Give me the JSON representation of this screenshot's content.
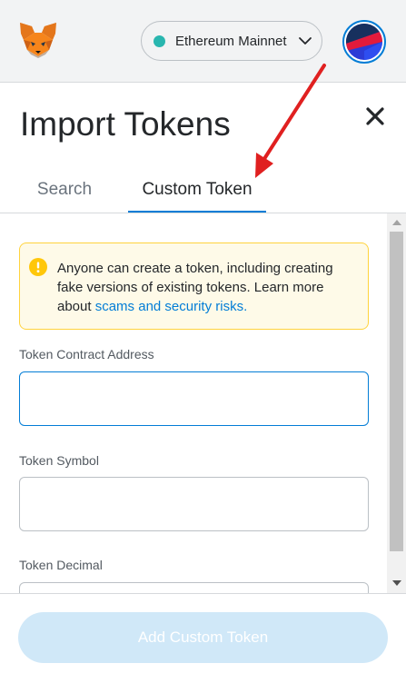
{
  "header": {
    "logo_icon": "metamask-fox-icon",
    "network": {
      "label": "Ethereum Mainnet",
      "dot_color": "#29b6af",
      "icon": "chevron-down-icon"
    },
    "account_icon": "account-avatar-icon"
  },
  "page": {
    "title": "Import Tokens",
    "close_icon": "close-icon",
    "tabs": [
      {
        "label": "Search",
        "active": false
      },
      {
        "label": "Custom Token",
        "active": true
      }
    ]
  },
  "warning": {
    "icon": "info-icon",
    "text": "Anyone can create a token, including creating fake versions of existing tokens. Learn more about ",
    "link_text": "scams and security risks."
  },
  "form": {
    "contract_address": {
      "label": "Token Contract Address",
      "value": "",
      "placeholder": ""
    },
    "symbol": {
      "label": "Token Symbol",
      "value": "",
      "placeholder": ""
    },
    "decimal": {
      "label": "Token Decimal",
      "value": "",
      "placeholder": ""
    }
  },
  "footer": {
    "add_button_label": "Add Custom Token",
    "add_button_enabled": false
  },
  "colors": {
    "accent": "#037dd6",
    "warning_bg": "#fefae8",
    "warning_border": "#ffd33d",
    "disabled_button": "#d0e8f8",
    "annotation_arrow": "#e02020"
  }
}
